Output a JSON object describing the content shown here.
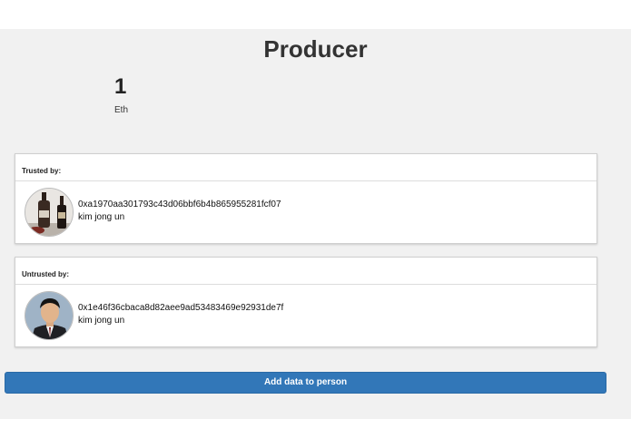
{
  "header": {
    "title": "Producer"
  },
  "balance": {
    "value": "1",
    "unit": "Eth"
  },
  "trusted": {
    "label": "Trusted by:",
    "person": {
      "address": "0xa1970aa301793c43d06bbf6b4b865955281fcf07",
      "name": "kim jong un",
      "avatar_icon": "bottle-avatar-icon"
    }
  },
  "untrusted": {
    "label": "Untrusted by:",
    "person": {
      "address": "0x1e46f36cbaca8d82aee9ad53483469e92931de7f",
      "name": "kim jong un",
      "avatar_icon": "portrait-avatar-icon"
    }
  },
  "actions": {
    "add_data_label": "Add data to person"
  },
  "colors": {
    "accent": "#3277b8",
    "background": "#f1f1f1"
  }
}
